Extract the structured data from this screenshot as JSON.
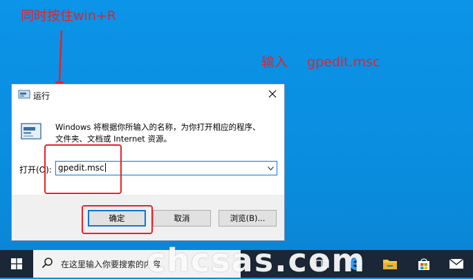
{
  "annotations": {
    "instruction_line1": "同时按住win+R",
    "instruction_line2_prefix": "输入",
    "instruction_line2_cmd": "gpedit.msc"
  },
  "dialog": {
    "title": "运行",
    "description_line1": "Windows 将根据你所输入的名称，为你打开相应的程序、",
    "description_line2": "文件夹、文档或 Internet 资源。",
    "open_label": "打开(O):",
    "input_value": "gpedit.msc",
    "buttons": {
      "ok": "确定",
      "cancel": "取消",
      "browse": "浏览(B)..."
    }
  },
  "taskbar": {
    "search_placeholder": "在这里输入你要搜索的内容"
  },
  "watermark": "chcsas.com",
  "colors": {
    "desktop": "#0a8fe0",
    "annotation_red": "#e8202a",
    "accent": "#0078d7",
    "taskbar": "#1b2636"
  },
  "icons": [
    "run-icon",
    "close-icon",
    "chevron-down-icon",
    "windows-icon",
    "search-icon",
    "task-view-icon",
    "edge-icon",
    "file-explorer-icon",
    "store-icon",
    "mail-icon"
  ]
}
